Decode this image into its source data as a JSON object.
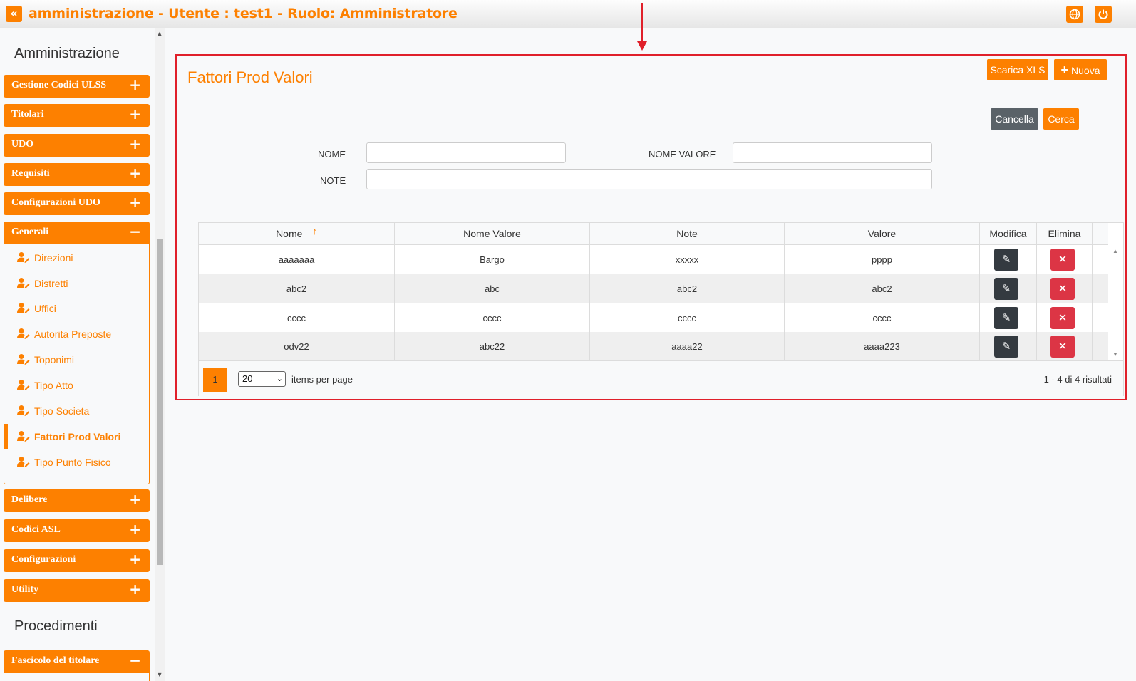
{
  "header": {
    "title": "amministrazione - Utente : test1 - Ruolo: Amministratore",
    "collapse_icon": "double-chevron-left-icon",
    "globe_icon": "globe-icon",
    "power_icon": "power-icon",
    "accent": "#fd8000"
  },
  "sidebar": {
    "section_admin": "Amministrazione",
    "section_proc": "Procedimenti",
    "menus": [
      {
        "label": "Gestione Codici ULSS",
        "icon": "+"
      },
      {
        "label": "Titolari",
        "icon": "+"
      },
      {
        "label": "UDO",
        "icon": "+"
      },
      {
        "label": "Requisiti",
        "icon": "+"
      },
      {
        "label": "Configurazioni UDO",
        "icon": "+"
      },
      {
        "label": "Generali",
        "icon": "−"
      },
      {
        "label": "Delibere",
        "icon": "+"
      },
      {
        "label": "Codici ASL",
        "icon": "+"
      },
      {
        "label": "Configurazioni",
        "icon": "+"
      },
      {
        "label": "Utility",
        "icon": "+"
      },
      {
        "label": "Fascicolo del titolare",
        "icon": "−"
      }
    ],
    "generali_items": [
      {
        "label": "Direzioni"
      },
      {
        "label": "Distretti"
      },
      {
        "label": "Uffici"
      },
      {
        "label": "Autorita Preposte"
      },
      {
        "label": "Toponimi"
      },
      {
        "label": "Tipo Atto"
      },
      {
        "label": "Tipo Societa"
      },
      {
        "label": "Fattori Prod Valori"
      },
      {
        "label": "Tipo Punto Fisico"
      }
    ]
  },
  "panel": {
    "title": "Fattori Prod Valori",
    "download_label": "Scarica XLS",
    "new_label": "Nuova",
    "new_icon": "+",
    "cancel_label": "Cancella",
    "search_label": "Cerca"
  },
  "filters": {
    "nome_label": "NOME",
    "nome_value": "",
    "nome_valore_label": "NOME VALORE",
    "nome_valore_value": "",
    "note_label": "NOTE",
    "note_value": ""
  },
  "table": {
    "columns": [
      "Nome",
      "Nome Valore",
      "Note",
      "Valore",
      "Modifica",
      "Elimina"
    ],
    "sort_icon": "↑",
    "rows": [
      {
        "nome": "aaaaaaa",
        "nome_valore": "Bargo",
        "note": "xxxxx",
        "valore": "pppp"
      },
      {
        "nome": "abc2",
        "nome_valore": "abc",
        "note": "abc2",
        "valore": "abc2"
      },
      {
        "nome": "cccc",
        "nome_valore": "cccc",
        "note": "cccc",
        "valore": "cccc"
      },
      {
        "nome": "odv22",
        "nome_valore": "abc22",
        "note": "aaaa22",
        "valore": "aaaa223"
      }
    ],
    "edit_icon": "✎",
    "delete_icon": "✕"
  },
  "pager": {
    "current_page": "1",
    "page_size": "20",
    "items_per_page_label": "items per page",
    "results": "1 - 4 di 4 risultati"
  }
}
